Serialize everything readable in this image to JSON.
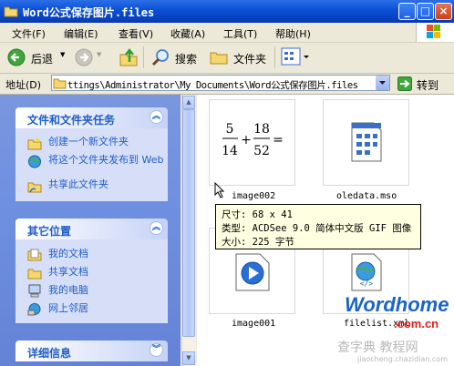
{
  "window": {
    "title": "Word公式保存图片.files"
  },
  "menu": {
    "items": [
      "文件(F)",
      "编辑(E)",
      "查看(V)",
      "收藏(A)",
      "工具(T)",
      "帮助(H)"
    ]
  },
  "toolbar": {
    "back": "后退",
    "search": "搜索",
    "folders": "文件夹"
  },
  "address": {
    "label": "地址(D)",
    "path": "ttings\\Administrator\\My Documents\\Word公式保存图片.files",
    "go": "转到"
  },
  "tasks": {
    "title": "文件和文件夹任务",
    "items": [
      "创建一个新文件夹",
      "将这个文件夹发布到 Web",
      "共享此文件夹"
    ]
  },
  "places": {
    "title": "其它位置",
    "items": [
      "我的文档",
      "共享文档",
      "我的电脑",
      "网上邻居"
    ]
  },
  "details": {
    "title": "详细信息"
  },
  "files": [
    {
      "name": "image002",
      "formula": {
        "a_num": "5",
        "a_den": "14",
        "op": "+",
        "b_num": "18",
        "b_den": "52",
        "eq": "="
      }
    },
    {
      "name": "oledata.mso"
    },
    {
      "name": "image001"
    },
    {
      "name": "filelist.xml"
    }
  ],
  "tooltip": {
    "size": "尺寸: 68 x 41",
    "type": "类型: ACDSee 9.0 简体中文版 GIF 图像",
    "filesize": "大小: 225 字节"
  },
  "watermark": {
    "brand": "Wordhome",
    "domain": ".com.cn",
    "site": "查字典 教程网",
    "url": "jiaocheng.chazidian.com"
  }
}
